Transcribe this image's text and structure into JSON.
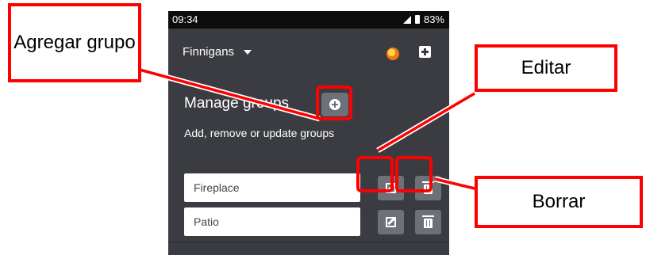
{
  "status_bar": {
    "time": "09:34",
    "battery": "83%"
  },
  "app_bar": {
    "venue": "Finnigans",
    "logo_icon": "orange-swirl-logo-icon",
    "add_icon": "plus-square-icon"
  },
  "manage": {
    "title": "Manage groups",
    "subtitle": "Add, remove or update groups",
    "add_group_icon": "plus-circle-icon"
  },
  "groups": [
    {
      "name": "Fireplace",
      "edit_icon": "edit-icon",
      "delete_icon": "trash-icon"
    },
    {
      "name": "Patio",
      "edit_icon": "edit-icon",
      "delete_icon": "trash-icon"
    }
  ],
  "annotations": {
    "add_group": "Agregar grupo",
    "edit": "Editar",
    "delete": "Borrar",
    "color": "#ff0000"
  }
}
